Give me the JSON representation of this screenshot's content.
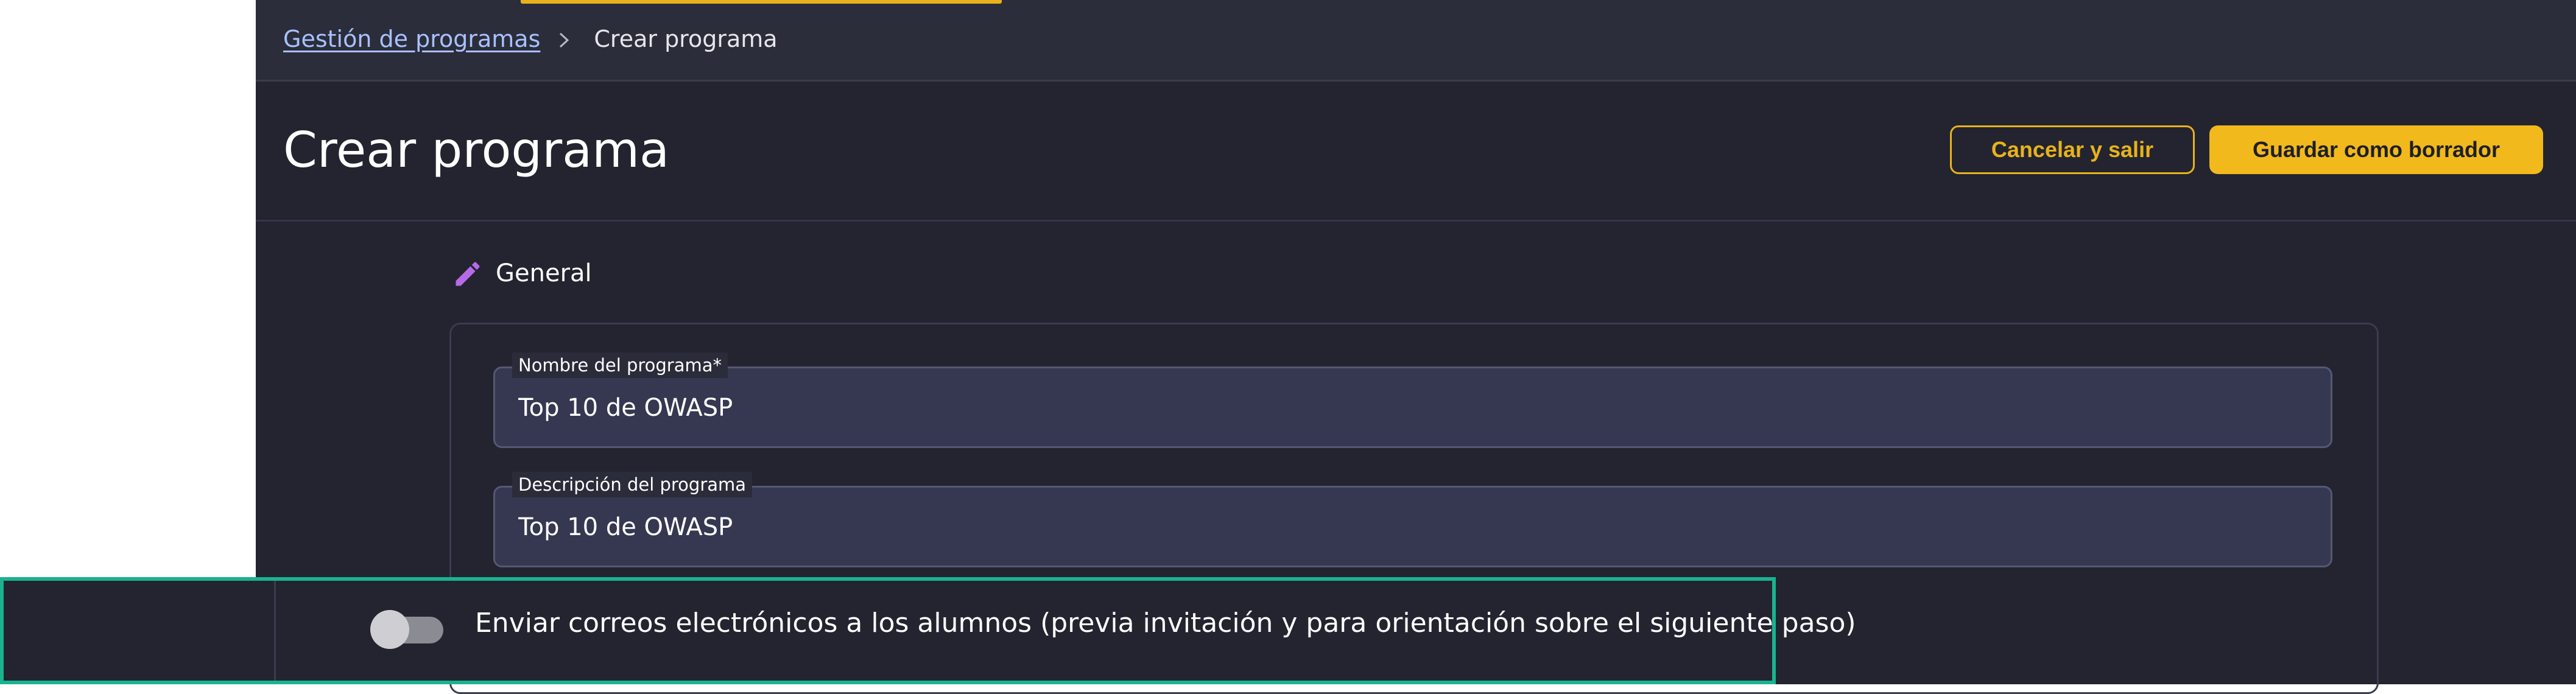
{
  "breadcrumb": {
    "parent_label": "Gestión de programas",
    "current_label": "Crear programa",
    "separator_icon": "chevron-right-icon"
  },
  "header": {
    "title": "Crear programa",
    "cancel_label": "Cancelar y salir",
    "save_label": "Guardar como borrador"
  },
  "section": {
    "icon": "pencil-icon",
    "title": "General"
  },
  "form": {
    "name_label": "Nombre del programa*",
    "name_value": "Top 10 de OWASP",
    "description_label": "Descripción del programa",
    "description_value": "Top 10 de OWASP"
  },
  "email_toggle": {
    "label": "Enviar correos electrónicos a los alumnos (previa invitación y para orientación sobre el siguiente paso)",
    "enabled": false
  },
  "colors": {
    "accent": "#f2b91c",
    "link": "#a8c1ff",
    "background": "#23242f",
    "highlight_border": "#19b38f",
    "icon_purple": "#b66ae8"
  }
}
